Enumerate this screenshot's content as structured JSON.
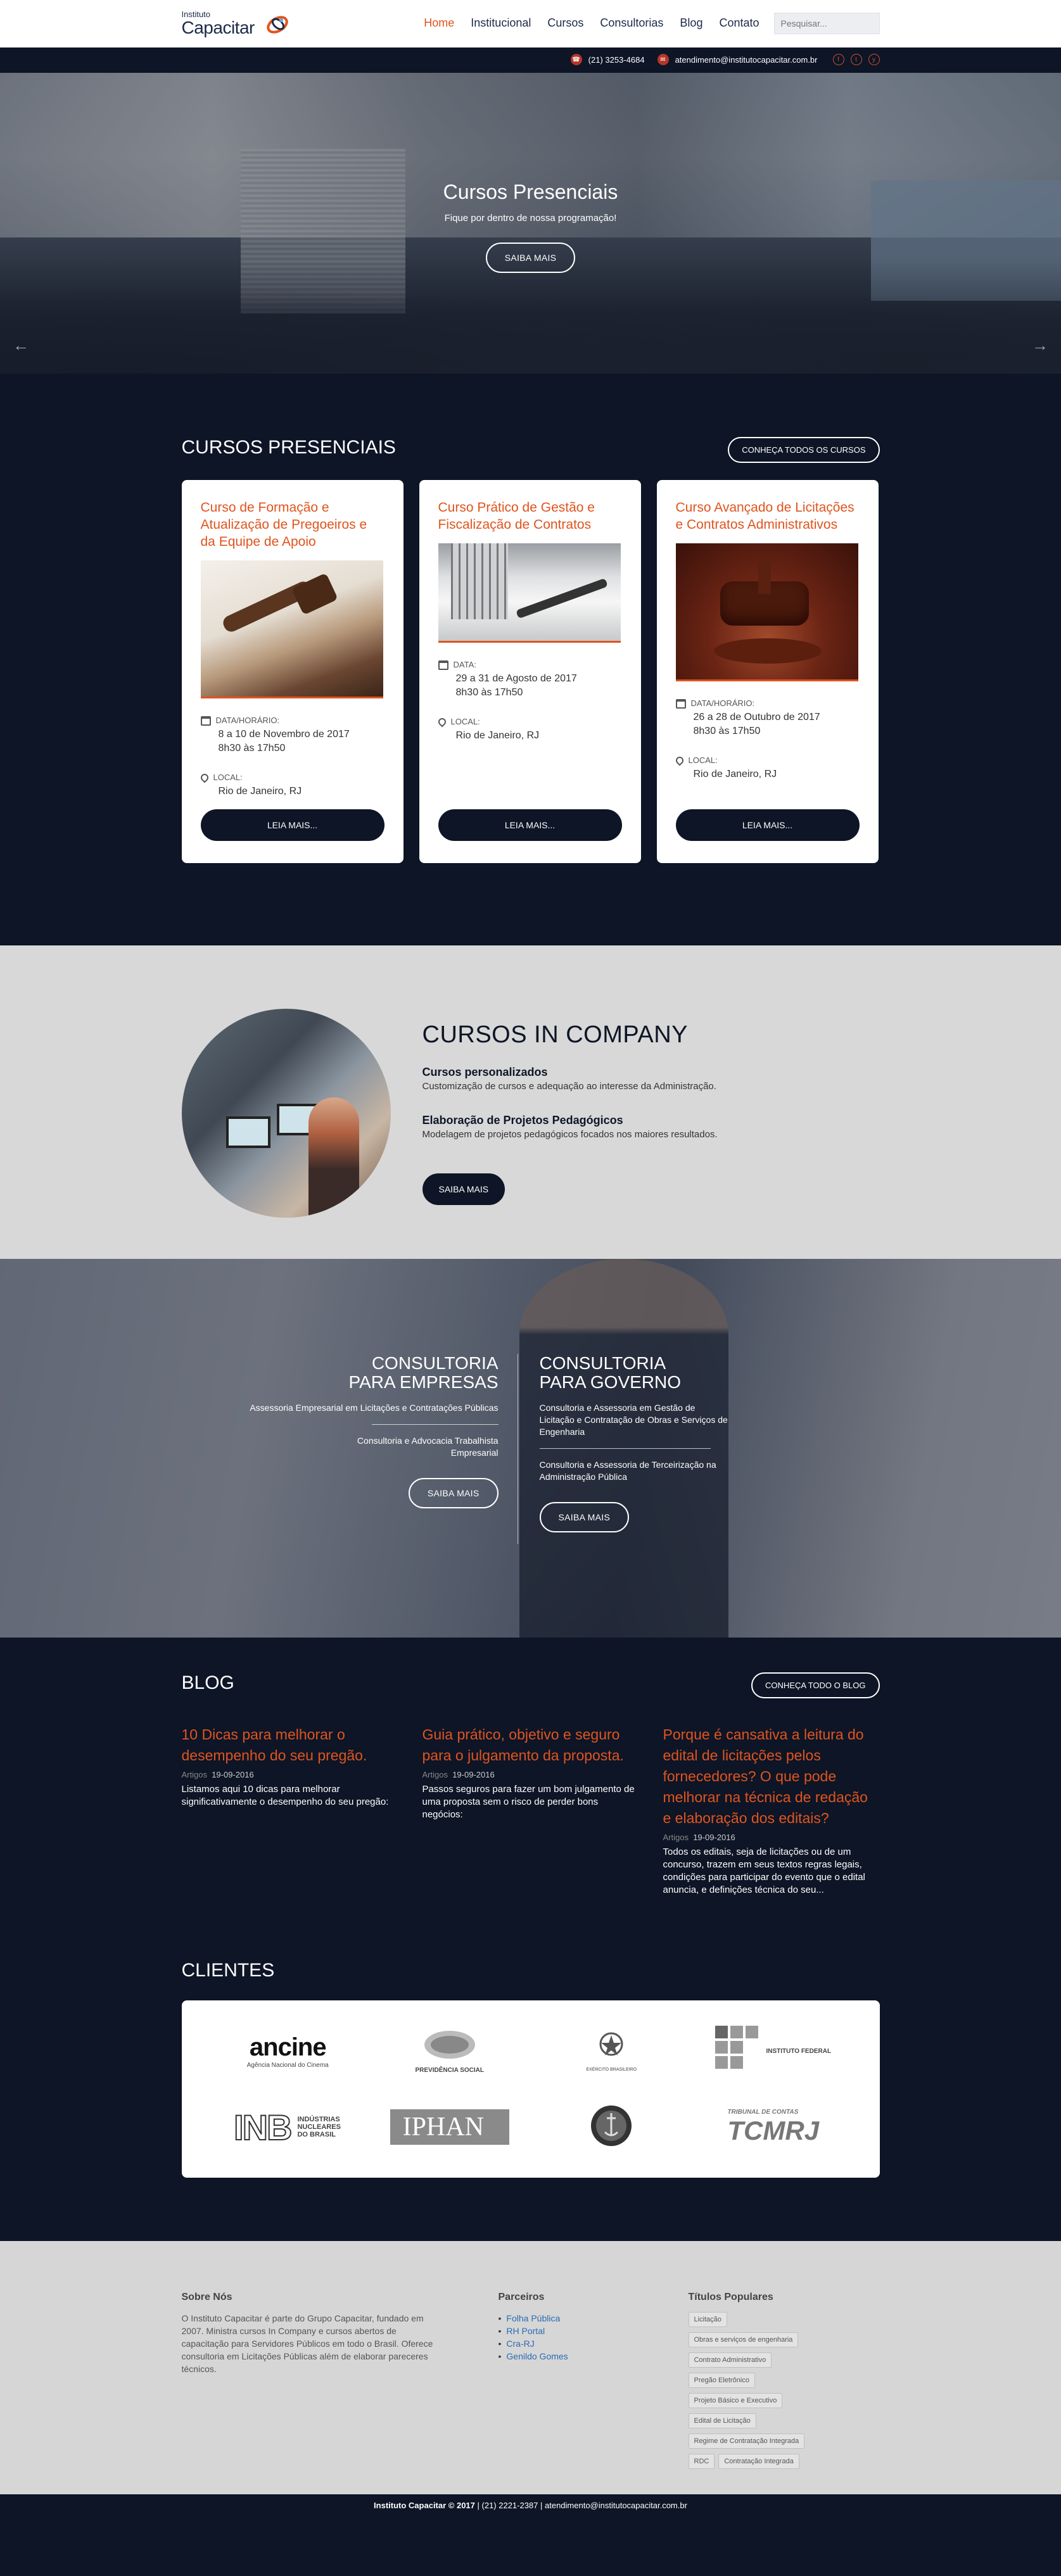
{
  "brand": {
    "small": "Instituto",
    "name": "Capacitar"
  },
  "nav": [
    {
      "label": "Home",
      "active": true
    },
    {
      "label": "Institucional"
    },
    {
      "label": "Cursos"
    },
    {
      "label": "Consultorias"
    },
    {
      "label": "Blog"
    },
    {
      "label": "Contato"
    }
  ],
  "search": {
    "placeholder": "Pesquisar..."
  },
  "topbar": {
    "phone": "(21) 3253-4684",
    "email": "atendimento@institutocapacitar.com.br",
    "social": [
      "f",
      "t",
      "y"
    ]
  },
  "hero": {
    "title": "Cursos Presenciais",
    "subtitle": "Fique por dentro de nossa programação!",
    "cta": "SAIBA MAIS",
    "prev": "←",
    "next": "→"
  },
  "cursos": {
    "title": "CURSOS PRESENCIAIS",
    "all_button": "CONHEÇA TODOS OS CURSOS",
    "cards": [
      {
        "title": "Curso de Formação e Atualização de Pregoeiros e da Equipe de Apoio",
        "date_label": "DATA/HORÁRIO:",
        "date": "8 a 10 de Novembro de 2017",
        "time": "8h30 às 17h50",
        "local_label": "LOCAL:",
        "local": "Rio de Janeiro, RJ",
        "button": "LEIA MAIS..."
      },
      {
        "title": "Curso Prático de Gestão e Fiscalização de Contratos",
        "date_label": "DATA:",
        "date": "29 a 31 de Agosto de 2017",
        "time": "8h30 às 17h50",
        "local_label": "LOCAL:",
        "local": "Rio de Janeiro, RJ",
        "button": "LEIA MAIS..."
      },
      {
        "title": "Curso Avançado de Licitações e Contratos Administrativos",
        "date_label": "DATA/HORÁRIO:",
        "date": "26 a 28 de Outubro de 2017",
        "time": "8h30 às 17h50",
        "local_label": "LOCAL:",
        "local": "Rio de Janeiro, RJ",
        "button": "LEIA MAIS..."
      }
    ]
  },
  "incompany": {
    "title": "CURSOS IN COMPANY",
    "items": [
      {
        "title": "Cursos personalizados",
        "text": "Customização de cursos e adequação ao interesse da Administração."
      },
      {
        "title": "Elaboração de Projetos Pedagógicos",
        "text": "Modelagem de projetos pedagógicos focados nos maiores resultados."
      }
    ],
    "cta": "SAIBA MAIS"
  },
  "consultoria": {
    "empresas": {
      "title1": "CONSULTORIA",
      "title2": "PARA EMPRESAS",
      "items": [
        "Assessoria Empresarial em Licitações e Contratações Públicas",
        "Consultoria e Advocacia Trabalhista Empresarial"
      ],
      "cta": "SAIBA MAIS"
    },
    "governo": {
      "title1": "CONSULTORIA",
      "title2": "PARA GOVERNO",
      "items": [
        "Consultoria e Assessoria em Gestão de Licitação e Contratação de Obras e Serviços de Engenharia",
        "Consultoria e Assessoria de Terceirização na Administração Pública"
      ],
      "cta": "SAIBA MAIS"
    }
  },
  "blog": {
    "title": "BLOG",
    "all_button": "CONHEÇA TODO O BLOG",
    "posts": [
      {
        "title": "10 Dicas para melhorar o desempenho do seu pregão.",
        "date_label": "Artigos",
        "date": "19-09-2016",
        "excerpt": "Listamos aqui 10 dicas para melhorar significativamente o desempenho do seu pregão:"
      },
      {
        "title": "Guia prático, objetivo e seguro para o julgamento da proposta.",
        "date_label": "Artigos",
        "date": "19-09-2016",
        "excerpt": "Passos seguros para fazer um bom julgamento de uma proposta sem o risco de perder bons negócios:"
      },
      {
        "title": "Porque é cansativa a leitura do edital de licitações pelos fornecedores? O que pode melhorar na técnica de redação e elaboração dos editais?",
        "date_label": "Artigos",
        "date": "19-09-2016",
        "excerpt": "Todos os editais, seja de licitações ou de um concurso, trazem em seus textos regras legais, condições para participar do evento que o edital anuncia, e definições técnica do seu..."
      }
    ]
  },
  "clientes": {
    "title": "CLIENTES",
    "logos": [
      {
        "name": "ancine",
        "sub": "Agência Nacional do Cinema"
      },
      {
        "name": "PREVIDÊNCIA SOCIAL",
        "sub": ""
      },
      {
        "name": "EXÉRCITO BRASILEIRO",
        "sub": ""
      },
      {
        "name": "INSTITUTO FEDERAL",
        "sub": ""
      },
      {
        "name": "INB",
        "sub": "INDÚSTRIAS NUCLEARES DO BRASIL"
      },
      {
        "name": "IPHAN",
        "sub": ""
      },
      {
        "name": "MARINHA",
        "sub": ""
      },
      {
        "name": "TCMRJ",
        "sub": "TRIBUNAL DE CONTAS"
      }
    ]
  },
  "footer": {
    "sobre": {
      "title": "Sobre Nós",
      "text": "O Instituto Capacitar é parte do Grupo Capacitar, fundado em 2007. Ministra cursos In Company e cursos abertos de capacitação para Servidores Públicos em todo o Brasil. Oferece consultoria em Licitações Públicas além de elaborar pareceres técnicos."
    },
    "parceiros": {
      "title": "Parceiros",
      "links": [
        "Folha Pública",
        "RH Portal",
        "Cra-RJ",
        "Genildo Gomes"
      ]
    },
    "tags": {
      "title": "Títulos Populares",
      "items": [
        "Licitação",
        "Obras e serviços de engenharia",
        "Contrato Administrativo",
        "Pregão Eletrônico",
        "Projeto Básico e Executivo",
        "Edital de Licitação",
        "Regime de Contratação Integrada",
        "RDC",
        "Contratação Integrada"
      ]
    },
    "copyright_brand": "Instituto Capacitar © 2017",
    "copyright_rest": " | (21) 2221-2387 | atendimento@institutocapacitar.com.br"
  },
  "colors": {
    "navy": "#0d1526",
    "orange": "#e0541e",
    "gray": "#d8d8d8"
  }
}
